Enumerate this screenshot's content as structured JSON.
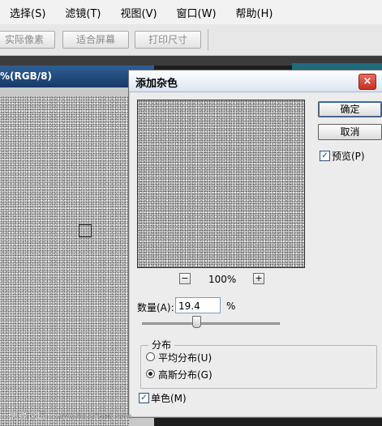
{
  "menubar": {
    "items": [
      "选择(S)",
      "滤镜(T)",
      "视图(V)",
      "窗口(W)",
      "帮助(H)"
    ]
  },
  "toolbar": {
    "buttons": [
      "实际像素",
      "适合屏幕",
      "打印尺寸"
    ]
  },
  "document": {
    "title": "%(RGB/8)"
  },
  "dialog": {
    "title": "添加杂色",
    "close_icon": "×",
    "ok_label": "确定",
    "cancel_label": "取消",
    "preview_label": "预览(P)",
    "preview_checked": true,
    "zoom_minus": "−",
    "zoom_plus": "+",
    "zoom_level": "100%",
    "amount_label": "数量(A):",
    "amount_value": "19.4",
    "amount_unit": "%",
    "distribution_group": "分布",
    "uniform_label": "平均分布(U)",
    "gaussian_label": "高斯分布(G)",
    "selected_distribution": "gaussian",
    "monochromatic_label": "单色(M)",
    "monochromatic_checked": true
  },
  "watermark": {
    "site_name": "思缘论坛",
    "url": "www.MISSYUAN.com"
  },
  "colors": {
    "doc_title_bg": "#163a66",
    "dialog_bg": "#ececec",
    "noise_base": "#c9c9c9"
  }
}
